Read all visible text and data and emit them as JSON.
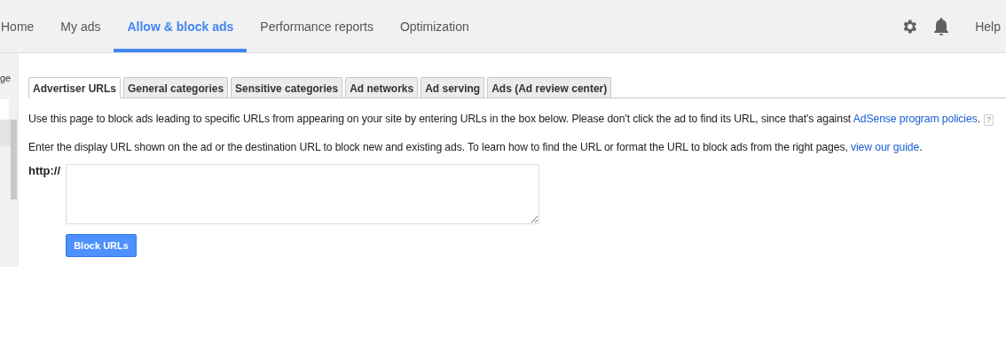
{
  "nav": {
    "items": [
      {
        "label": "Home",
        "selected": false
      },
      {
        "label": "My ads",
        "selected": false
      },
      {
        "label": "Allow & block ads",
        "selected": true
      },
      {
        "label": "Performance reports",
        "selected": false
      },
      {
        "label": "Optimization",
        "selected": false
      }
    ],
    "help": "Help"
  },
  "sidebar": {
    "label": "ge"
  },
  "tabs": [
    {
      "label": "Advertiser URLs",
      "selected": true
    },
    {
      "label": "General categories",
      "selected": false
    },
    {
      "label": "Sensitive categories",
      "selected": false
    },
    {
      "label": "Ad networks",
      "selected": false
    },
    {
      "label": "Ad serving",
      "selected": false
    },
    {
      "label": "Ads (Ad review center)",
      "selected": false
    }
  ],
  "intro": {
    "text": "Use this page to block ads leading to specific URLs from appearing on your site by entering URLs in the box below. Please don't click the ad to find its URL, since that's against ",
    "link": "AdSense program policies",
    "end": ".",
    "help_mark": "?"
  },
  "guide": {
    "text": "Enter the display URL shown on the ad or the destination URL to block new and existing ads. To learn how to find the URL or format the URL to block ads from the right pages, ",
    "link": "view our guide",
    "end": "."
  },
  "url_field": {
    "prefix": "http://"
  },
  "button": "Block URLs"
}
